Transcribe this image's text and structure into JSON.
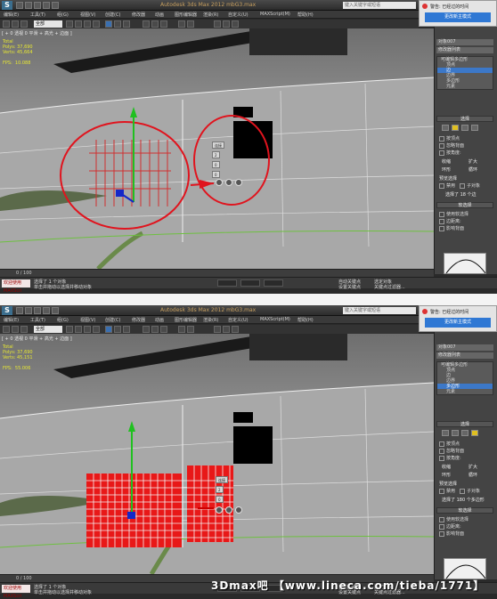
{
  "app": {
    "title": "Autodesk 3ds Max 2012    mbG3.max",
    "search_placeholder": "键入关键字或短语",
    "logo_letter": "S"
  },
  "menubar": {
    "items": [
      "编辑(E)",
      "工具(T)",
      "组(G)",
      "视图(V)",
      "创建(C)",
      "修改器",
      "动画",
      "图形编辑器",
      "渲染(R)",
      "自定义(U)",
      "MAXScript(M)",
      "帮助(H)"
    ]
  },
  "toolbar": {
    "selection_filter": "全部"
  },
  "shots": [
    {
      "viewport_label": "[ + 0 透视 0 平滑 + 高光 + 边面 ]",
      "stats_text": "Total\nPolys: 37,690\nVerts: 45,664\n\nFPS:  10.088",
      "command_panel": {
        "object_name": "对象007",
        "modifier_list": "修改器列表",
        "stack_items": [
          "可编辑多边形",
          "顶点",
          "边",
          "边界",
          "多边形",
          "元素"
        ],
        "selected_stack_index": 2,
        "selection_rollout": "选择",
        "checkboxes": [
          "按顶点",
          "忽略背面",
          "按角度:",
          "收缩",
          "扩大",
          "环形",
          "循环"
        ],
        "preview_label": "预览选择",
        "preview_options": [
          "禁用",
          "子对象",
          "多个"
        ],
        "selection_status": "选择了 18 个边",
        "soft_selection_rollout": "软选择",
        "soft_options": [
          "使用软选择",
          "边距离:",
          "影响背面"
        ]
      },
      "popup": {
        "message": "警告: 已经过的时间",
        "button": "更改新主模式"
      },
      "caddy": {
        "label": "连接",
        "value1": "2",
        "value2": "0",
        "value3": "0"
      },
      "timeline": {
        "frame": "0 / 100"
      },
      "status": {
        "maxscript": "欢迎使用 MAXScri",
        "line1": "选择了 1 个对象",
        "line2": "单击并拖动以选择并移动对象",
        "autokey": "自动关键点",
        "selected": "选定对象",
        "setkey": "设置关键点",
        "filter": "关键点过滤器..."
      }
    },
    {
      "viewport_label": "[ + 0 透视 0 平滑 + 高光 + 边面 ]",
      "stats_text": "Total\nPolys: 37,690\nVerts: 45,151\n\nFPS:  55.006",
      "command_panel": {
        "object_name": "对象007",
        "modifier_list": "修改器列表",
        "stack_items": [
          "可编辑多边形",
          "顶点",
          "边",
          "边界",
          "多边形",
          "元素"
        ],
        "selected_stack_index": 4,
        "selection_rollout": "选择",
        "checkboxes": [
          "按顶点",
          "忽略背面",
          "按角度:",
          "收缩",
          "扩大",
          "环形",
          "循环"
        ],
        "preview_label": "预览选择",
        "preview_options": [
          "禁用",
          "子对象",
          "多个"
        ],
        "selection_status": "选择了 180 个多边形",
        "soft_selection_rollout": "软选择",
        "soft_options": [
          "使用软选择",
          "边距离:",
          "影响背面"
        ]
      },
      "popup": {
        "message": "警告: 已经过的时间",
        "button": "更改新主模式"
      },
      "caddy": {
        "label": "连接",
        "value1": "2",
        "value2": "0",
        "value3": "0"
      },
      "timeline": {
        "frame": "0 / 100"
      },
      "status": {
        "maxscript": "欢迎使用 MAXScri",
        "line1": "选择了 1 个对象",
        "line2": "单击并拖动以选择并移动对象",
        "autokey": "自动关键点",
        "selected": "选定对象",
        "setkey": "设置关键点",
        "filter": "关键点过滤器..."
      }
    }
  ],
  "watermark": "3Dmax吧 【www.lineca.com/tieba/1771】",
  "colors": {
    "annotation_red": "#e0141e",
    "selected_poly": "#e81818",
    "gizmo_blue": "#1428c8",
    "gizmo_green": "#20c020",
    "accent_blue": "#2f78d4"
  }
}
